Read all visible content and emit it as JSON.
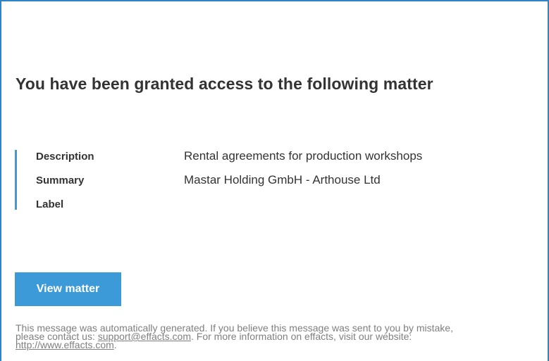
{
  "email": {
    "heading": "You have been granted access to the following matter",
    "details": [
      {
        "label": "Description",
        "value": "Rental agreements for production workshops"
      },
      {
        "label": "Summary",
        "value": "Mastar Holding GmbH - Arthouse Ltd"
      },
      {
        "label": "Label",
        "value": ""
      }
    ],
    "button_label": "View matter",
    "footer": {
      "text_1": "This message was automatically generated. If you believe this message was sent to you by mistake,",
      "text_2": "please contact us: ",
      "support_email": "support@effacts.com",
      "text_3": ". For more information on effacts, visit our website:",
      "website": "http://www.effacts.com",
      "text_4": "."
    }
  },
  "colors": {
    "frame_border": "#2f84c9",
    "accent_bar": "#4d94d2",
    "button_bg": "#3d9ad9",
    "text": "#333333",
    "footer_text": "#7f7f7f"
  }
}
